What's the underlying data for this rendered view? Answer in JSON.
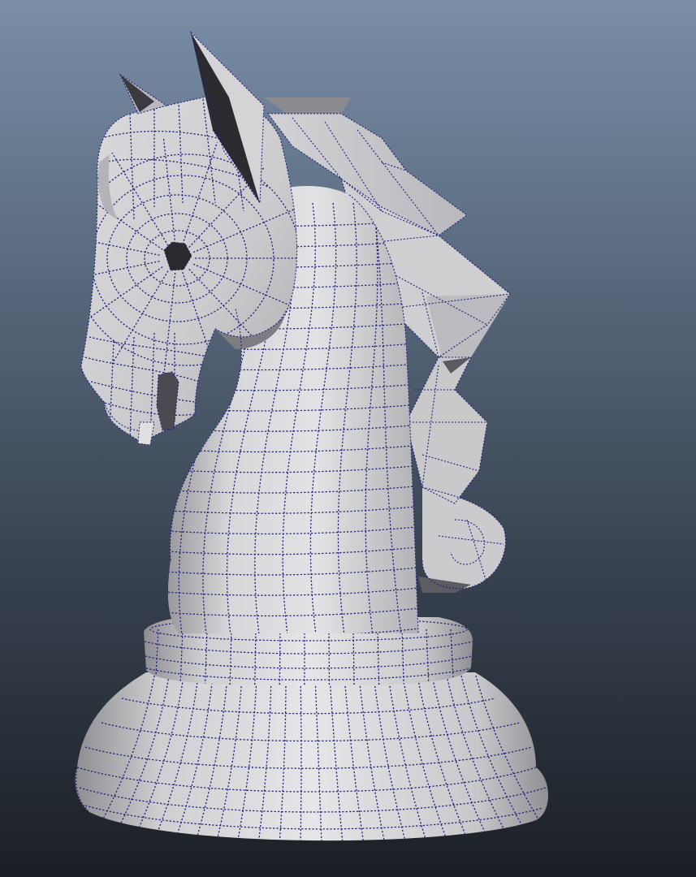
{
  "viewport": {
    "background_top": "#7a8ea6",
    "background_bottom": "#1b1f25",
    "object": "chess-knight",
    "display_mode": "wireframe-on-shaded",
    "wire_color": "#22227a",
    "surface_color": "#d4d4d6"
  }
}
